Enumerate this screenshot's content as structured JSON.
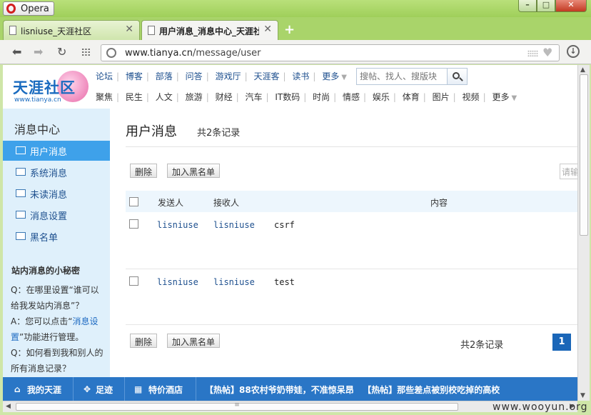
{
  "browser": {
    "app_name": "Opera",
    "tabs": [
      {
        "label": "lisniuse_天涯社区"
      },
      {
        "label": "用户消息_消息中心_天涯社区"
      }
    ],
    "url_prefix": "www.tianya.cn",
    "url_path": "/message/user"
  },
  "site": {
    "logo_text": "天涯社区",
    "logo_url": "www.tianya.cn",
    "nav_row_1": [
      "论坛",
      "博客",
      "部落",
      "问答",
      "游戏厅",
      "天涯客",
      "读书",
      "更多"
    ],
    "nav_row_2": [
      "聚焦",
      "民生",
      "人文",
      "旅游",
      "财经",
      "汽车",
      "IT数码",
      "时尚",
      "情感",
      "娱乐",
      "体育",
      "图片",
      "视频",
      "更多"
    ],
    "search_placeholder": "搜帖、找人、搜版块"
  },
  "sidebar": {
    "title": "消息中心",
    "items": [
      {
        "label": "用户消息",
        "icon": "envelope-icon",
        "active": true
      },
      {
        "label": "系统消息",
        "icon": "speaker-icon",
        "active": false
      },
      {
        "label": "未读消息",
        "icon": "unread-mail-icon",
        "active": false
      },
      {
        "label": "消息设置",
        "icon": "gear-icon",
        "active": false
      },
      {
        "label": "黑名单",
        "icon": "user-block-icon",
        "active": false
      }
    ],
    "tips_title": "站内消息的小秘密",
    "tips_q1": "Q：在哪里设置“谁可以给我发站内消息”？",
    "tips_a1_prefix": "A：您可以点击“",
    "tips_a1_link": "消息设置",
    "tips_a1_suffix": "”功能进行管理。",
    "tips_q2": "Q：如何看到我和别人的所有消息记录？"
  },
  "main": {
    "title": "用户消息",
    "record_count": "共2条记录",
    "delete_label": "删除",
    "blacklist_label": "加入黑名单",
    "peek_input_text": "请输",
    "columns": {
      "sender": "发送人",
      "receiver": "接收人",
      "content": "内容"
    },
    "rows": [
      {
        "sender": "lisniuse",
        "receiver": "lisniuse",
        "content": "csrf"
      },
      {
        "sender": "lisniuse",
        "receiver": "lisniuse",
        "content": "test"
      }
    ],
    "footer_count": "共2条记录",
    "page": "1"
  },
  "bottombar": {
    "my_tianya": "我的天涯",
    "footprints": "足迹",
    "hotel": "特价酒店",
    "hot_post_1": "【热帖】88农村爷奶带娃，不准惊呆昂",
    "hot_post_2": "【热帖】那些差点被别校吃掉的高校"
  },
  "watermark": "www.wooyun.org",
  "colors": {
    "accent": "#3ea1ea",
    "bottombar": "#2a76c6",
    "link": "#1d4f8e",
    "page_active": "#1a66b8"
  }
}
